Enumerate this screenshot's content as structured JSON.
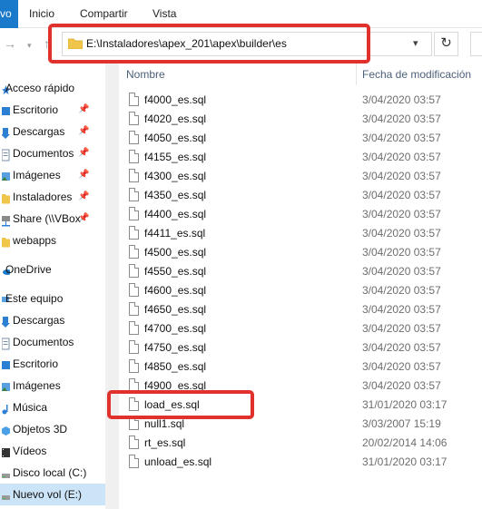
{
  "ribbon": {
    "file_tab": "vo",
    "tabs": [
      "Inicio",
      "Compartir",
      "Vista"
    ]
  },
  "address": {
    "path": "E:\\Instaladores\\apex_201\\apex\\builder\\es"
  },
  "sidebar": {
    "quick_access": "Acceso rápido",
    "quick_items": [
      {
        "label": "Escritorio",
        "icon": "desktop-icon"
      },
      {
        "label": "Descargas",
        "icon": "download-icon"
      },
      {
        "label": "Documentos",
        "icon": "documents-icon"
      },
      {
        "label": "Imágenes",
        "icon": "pictures-icon"
      },
      {
        "label": "Instaladores",
        "icon": "folder-icon"
      },
      {
        "label": "Share (\\\\VBox",
        "icon": "network-drive-icon"
      },
      {
        "label": "webapps",
        "icon": "folder-icon"
      }
    ],
    "onedrive": "OneDrive",
    "this_pc": "Este equipo",
    "pc_items": [
      {
        "label": "Descargas",
        "icon": "download-icon"
      },
      {
        "label": "Documentos",
        "icon": "documents-icon"
      },
      {
        "label": "Escritorio",
        "icon": "desktop-icon"
      },
      {
        "label": "Imágenes",
        "icon": "pictures-icon"
      },
      {
        "label": "Música",
        "icon": "music-icon"
      },
      {
        "label": "Objetos 3D",
        "icon": "3d-objects-icon"
      },
      {
        "label": "Vídeos",
        "icon": "videos-icon"
      },
      {
        "label": "Disco local (C:)",
        "icon": "drive-icon"
      },
      {
        "label": "Nuevo vol (E:)",
        "icon": "drive-icon"
      }
    ]
  },
  "columns": {
    "name": "Nombre",
    "date": "Fecha de modificación"
  },
  "files": [
    {
      "name": "f4000_es.sql",
      "date": "3/04/2020 03:57"
    },
    {
      "name": "f4020_es.sql",
      "date": "3/04/2020 03:57"
    },
    {
      "name": "f4050_es.sql",
      "date": "3/04/2020 03:57"
    },
    {
      "name": "f4155_es.sql",
      "date": "3/04/2020 03:57"
    },
    {
      "name": "f4300_es.sql",
      "date": "3/04/2020 03:57"
    },
    {
      "name": "f4350_es.sql",
      "date": "3/04/2020 03:57"
    },
    {
      "name": "f4400_es.sql",
      "date": "3/04/2020 03:57"
    },
    {
      "name": "f4411_es.sql",
      "date": "3/04/2020 03:57"
    },
    {
      "name": "f4500_es.sql",
      "date": "3/04/2020 03:57"
    },
    {
      "name": "f4550_es.sql",
      "date": "3/04/2020 03:57"
    },
    {
      "name": "f4600_es.sql",
      "date": "3/04/2020 03:57"
    },
    {
      "name": "f4650_es.sql",
      "date": "3/04/2020 03:57"
    },
    {
      "name": "f4700_es.sql",
      "date": "3/04/2020 03:57"
    },
    {
      "name": "f4750_es.sql",
      "date": "3/04/2020 03:57"
    },
    {
      "name": "f4850_es.sql",
      "date": "3/04/2020 03:57"
    },
    {
      "name": "f4900_es.sql",
      "date": "3/04/2020 03:57"
    },
    {
      "name": "load_es.sql",
      "date": "31/01/2020 03:17"
    },
    {
      "name": "null1.sql",
      "date": "3/03/2007 15:19"
    },
    {
      "name": "rt_es.sql",
      "date": "20/02/2014 14:06"
    },
    {
      "name": "unload_es.sql",
      "date": "31/01/2020 03:17"
    }
  ],
  "colors": {
    "accent": "#1979ca",
    "highlight": "#e0312d",
    "selected": "#cce4f7",
    "folder": "#f0c64a"
  }
}
